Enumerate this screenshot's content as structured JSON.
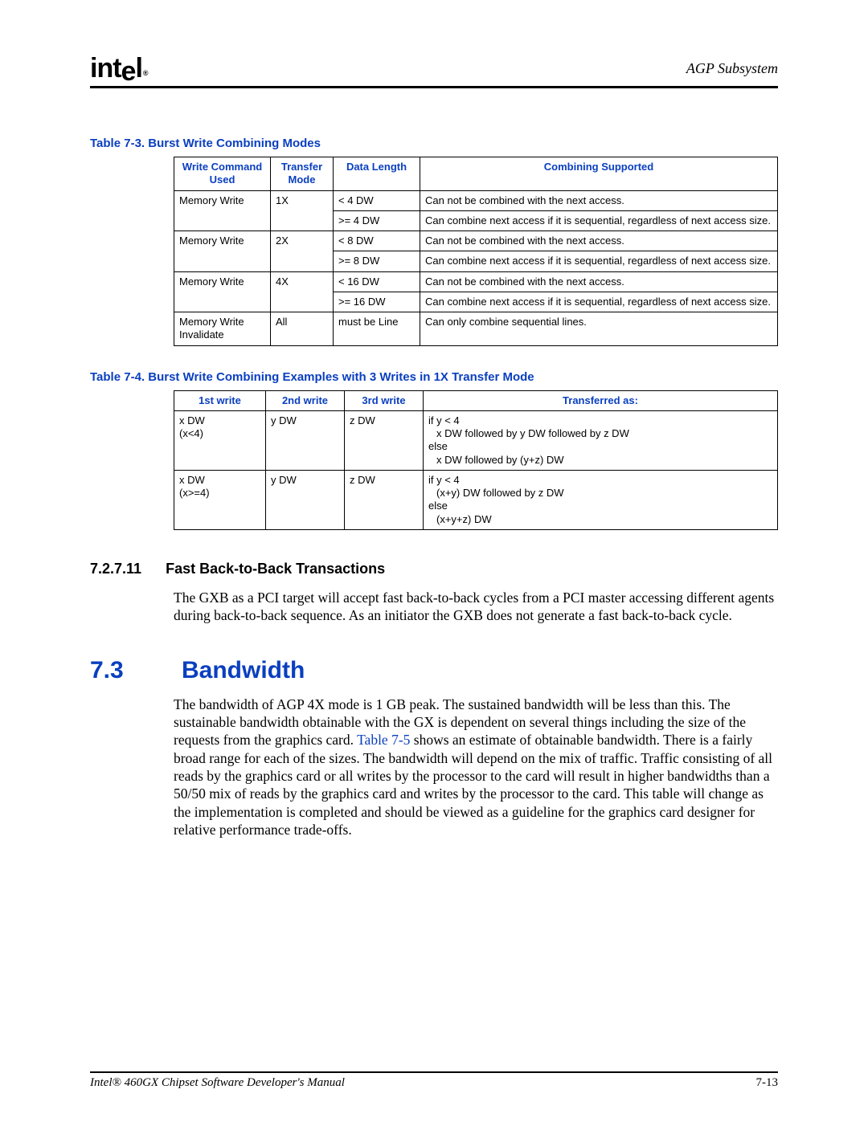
{
  "header": {
    "section": "AGP Subsystem"
  },
  "table73": {
    "caption": "Table 7-3. Burst Write Combining Modes",
    "headers": {
      "c1": "Write Command Used",
      "c2": "Transfer Mode",
      "c3": "Data Length",
      "c4": "Combining Supported"
    },
    "rows": {
      "r1": {
        "cmd": "Memory Write",
        "mode": "1X",
        "len": "< 4 DW",
        "comb": "Can not be combined with the next access."
      },
      "r2": {
        "len": ">= 4 DW",
        "comb": "Can combine next access if it is sequential, regardless of next access size."
      },
      "r3": {
        "cmd": "Memory Write",
        "mode": "2X",
        "len": "< 8 DW",
        "comb": "Can not be combined with the next access."
      },
      "r4": {
        "len": ">= 8 DW",
        "comb": "Can combine next access if it is sequential, regardless of next access size."
      },
      "r5": {
        "cmd": "Memory Write",
        "mode": "4X",
        "len": "< 16 DW",
        "comb": "Can not be combined with the next access."
      },
      "r6": {
        "len": ">= 16 DW",
        "comb": "Can combine next access if it is sequential, regardless of next access size."
      },
      "r7": {
        "cmd": "Memory Write Invalidate",
        "mode": "All",
        "len": "must be Line",
        "comb": "Can only combine sequential lines."
      }
    }
  },
  "table74": {
    "caption": "Table 7-4. Burst Write Combining Examples with 3 Writes in 1X Transfer Mode",
    "headers": {
      "c1": "1st write",
      "c2": "2nd write",
      "c3": "3rd write",
      "c4": "Transferred as:"
    },
    "rows": {
      "r1": {
        "w1a": "x DW",
        "w1b": "(x<4)",
        "w2": "y DW",
        "w3": "z DW",
        "t_if": "if y < 4",
        "t_ifbody": "x DW followed by y DW followed by z DW",
        "t_else": "else",
        "t_elsebody": "x DW followed by (y+z) DW"
      },
      "r2": {
        "w1a": "x DW",
        "w1b": "(x>=4)",
        "w2": "y DW",
        "w3": "z DW",
        "t_if": "if y < 4",
        "t_ifbody": "(x+y) DW followed by z DW",
        "t_else": "else",
        "t_elsebody": "(x+y+z) DW"
      }
    }
  },
  "subsection": {
    "num": "7.2.7.11",
    "title": "Fast Back-to-Back Transactions",
    "body": "The GXB as a PCI target will accept fast back-to-back cycles from a PCI master accessing different agents during back-to-back sequence. As an initiator the GXB does not generate a fast back-to-back cycle."
  },
  "section73": {
    "num": "7.3",
    "title": "Bandwidth",
    "body_a": "The bandwidth of AGP 4X mode is 1 GB peak. The sustained bandwidth will be less than this. The sustainable bandwidth obtainable with the GX is dependent on several things including the size of the requests from the graphics card. ",
    "tableref": "Table 7-5",
    "body_b": " shows an estimate of obtainable bandwidth. There is a fairly broad range for each of the sizes. The bandwidth will depend on the mix of traffic. Traffic consisting of all reads by the graphics card or all writes by the processor to the card will result in higher bandwidths than a 50/50 mix of reads by the graphics card and writes by the processor to the card. This table will change as the implementation is completed and should be viewed as a guideline for the graphics card designer for relative performance trade-offs."
  },
  "footer": {
    "left": "Intel® 460GX Chipset Software Developer's Manual",
    "right": "7-13"
  }
}
